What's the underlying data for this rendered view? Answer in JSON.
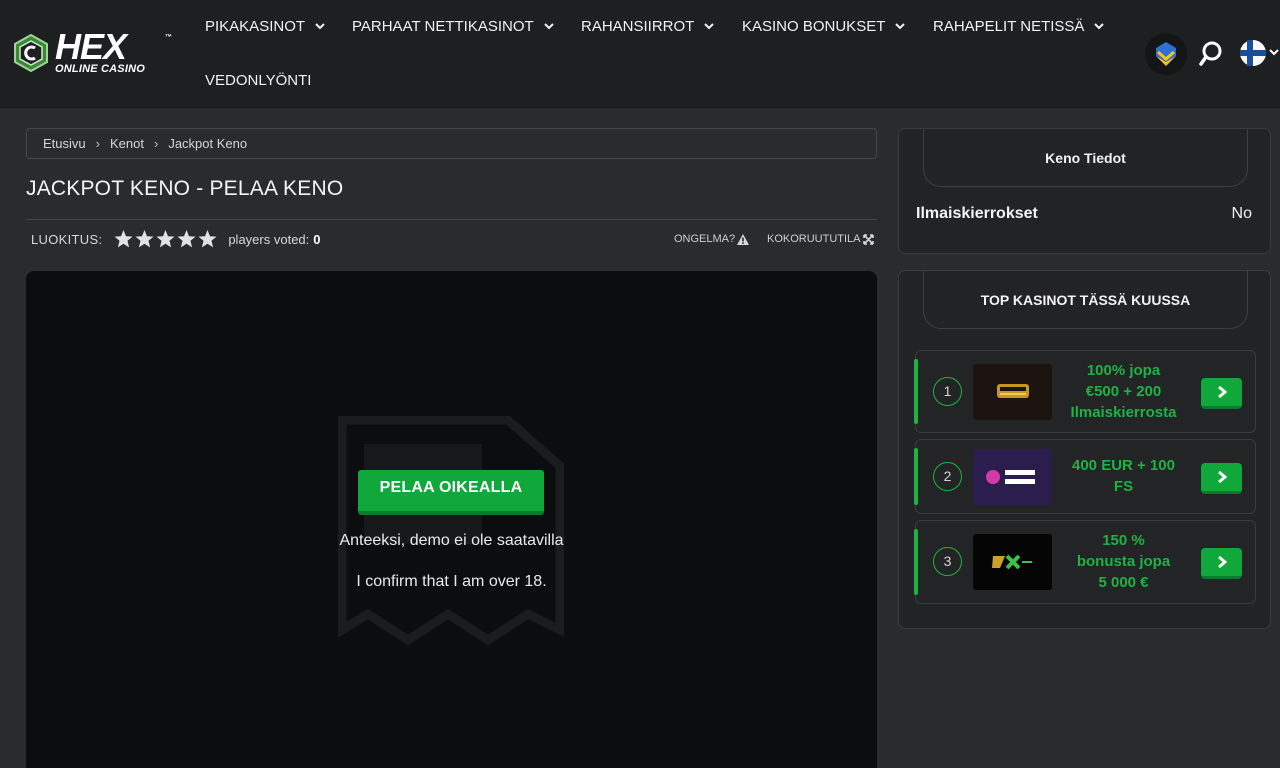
{
  "brand": {
    "name": "HEX",
    "tagline": "ONLINE CASINO",
    "tm": "™"
  },
  "nav": {
    "items": [
      {
        "label": "PIKAKASINOT",
        "dropdown": true
      },
      {
        "label": "PARHAAT NETTIKASINOT",
        "dropdown": true
      },
      {
        "label": "RAHANSIIRROT",
        "dropdown": true
      },
      {
        "label": "KASINO BONUKSET",
        "dropdown": true
      },
      {
        "label": "RAHAPELIT NETISSÄ",
        "dropdown": true
      },
      {
        "label": "VEDONLYÖNTI",
        "dropdown": false
      }
    ],
    "icons": [
      "support-ukraine-icon",
      "search-icon",
      "finland-flag-icon"
    ]
  },
  "breadcrumb": {
    "items": [
      "Etusivu",
      "Kenot",
      "Jackpot Keno"
    ],
    "separator": "›"
  },
  "page": {
    "title": "JACKPOT KENO - PELAA KENO",
    "rating_label": "LUOKITUS:",
    "stars": 5,
    "voted_label": "players voted:",
    "voted_count": "0",
    "report_label": "ONGELMA?",
    "fullscreen_label": "KOKORUUTUTILA"
  },
  "game": {
    "play_button": "PELAA OIKEALLA",
    "demo_message": "Anteeksi, demo ei ole saatavilla",
    "age_message": "I confirm that I am over 18."
  },
  "sidebar": {
    "info": {
      "title": "Keno Tiedot",
      "rows": [
        {
          "key": "Ilmaiskierrokset",
          "value": "No"
        }
      ]
    },
    "top": {
      "title": "TOP KASINOT TÄSSÄ KUUSSA",
      "casinos": [
        {
          "rank": "1",
          "logo": "fat-pirate-logo",
          "bonus_lines": [
            "100% jopa",
            "€500 + 200",
            "Ilmaiskierrosta"
          ]
        },
        {
          "rank": "2",
          "logo": "win-spirit-logo",
          "bonus_lines": [
            "400 EUR + 100",
            "FS"
          ]
        },
        {
          "rank": "3",
          "logo": "rx-casino-logo",
          "bonus_lines": [
            "150 %",
            "bonusta jopa",
            "5 000 €"
          ]
        }
      ]
    }
  },
  "colors": {
    "accent_green": "#1db344",
    "button_green": "#10a83a",
    "header_bg": "#1e1f21",
    "page_bg": "#2a2b2d"
  }
}
